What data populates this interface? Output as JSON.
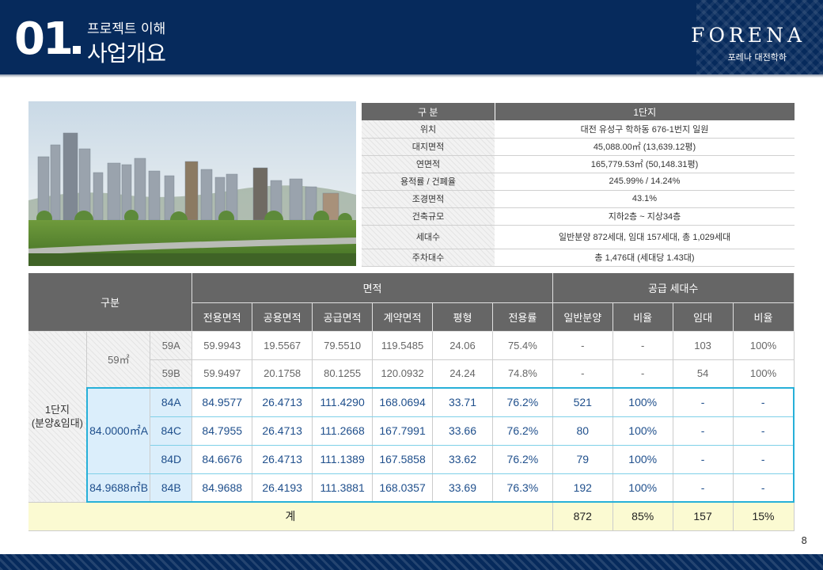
{
  "header": {
    "section_number": "01",
    "subtitle": "프로젝트 이해",
    "title": "사업개요",
    "brand": "FORENA",
    "brand_sub": "포레나 대전학하"
  },
  "info_table": {
    "col1": "구 분",
    "col2": "1단지",
    "rows": [
      {
        "label": "위치",
        "value": "대전 유성구 학하동 676-1번지 일원"
      },
      {
        "label": "대지면적",
        "value": "45,088.00㎡ (13,639.12평)"
      },
      {
        "label": "연면적",
        "value": "165,779.53㎡ (50,148.31평)"
      },
      {
        "label": "용적률 / 건폐율",
        "value": "245.99% / 14.24%"
      },
      {
        "label": "조경면적",
        "value": "43.1%"
      },
      {
        "label": "건축규모",
        "value": "지하2층 ~ 지상34층"
      },
      {
        "label": "세대수",
        "value": "일반분양 872세대, 임대 157세대, 총 1,029세대"
      },
      {
        "label": "주차대수",
        "value": "총 1,476대 (세대당 1.43대)"
      }
    ]
  },
  "main_table": {
    "h_gubun": "구분",
    "h_area": "면적",
    "h_supply": "공급 세대수",
    "sub_headers": [
      "전용면적",
      "공용면적",
      "공급면적",
      "계약면적",
      "평형",
      "전용률",
      "일반분양",
      "비율",
      "임대",
      "비율"
    ],
    "group_label": "1단지\n(분양&임대)",
    "size_59": "59㎡",
    "size_84a": "84.0000㎡A",
    "size_84b": "84.9688㎡B",
    "rows": [
      {
        "type": "59A",
        "cells": [
          "59.9943",
          "19.5567",
          "79.5510",
          "119.5485",
          "24.06",
          "75.4%",
          "-",
          "-",
          "103",
          "100%"
        ]
      },
      {
        "type": "59B",
        "cells": [
          "59.9497",
          "20.1758",
          "80.1255",
          "120.0932",
          "24.24",
          "74.8%",
          "-",
          "-",
          "54",
          "100%"
        ]
      },
      {
        "type": "84A",
        "cells": [
          "84.9577",
          "26.4713",
          "111.4290",
          "168.0694",
          "33.71",
          "76.2%",
          "521",
          "100%",
          "-",
          "-"
        ]
      },
      {
        "type": "84C",
        "cells": [
          "84.7955",
          "26.4713",
          "111.2668",
          "167.7991",
          "33.66",
          "76.2%",
          "80",
          "100%",
          "-",
          "-"
        ]
      },
      {
        "type": "84D",
        "cells": [
          "84.6676",
          "26.4713",
          "111.1389",
          "167.5858",
          "33.62",
          "76.2%",
          "79",
          "100%",
          "-",
          "-"
        ]
      },
      {
        "type": "84B",
        "cells": [
          "84.9688",
          "26.4193",
          "111.3881",
          "168.0357",
          "33.69",
          "76.3%",
          "192",
          "100%",
          "-",
          "-"
        ]
      }
    ],
    "total_label": "계",
    "total_cells": [
      "872",
      "85%",
      "157",
      "15%"
    ]
  },
  "page_number": "8"
}
